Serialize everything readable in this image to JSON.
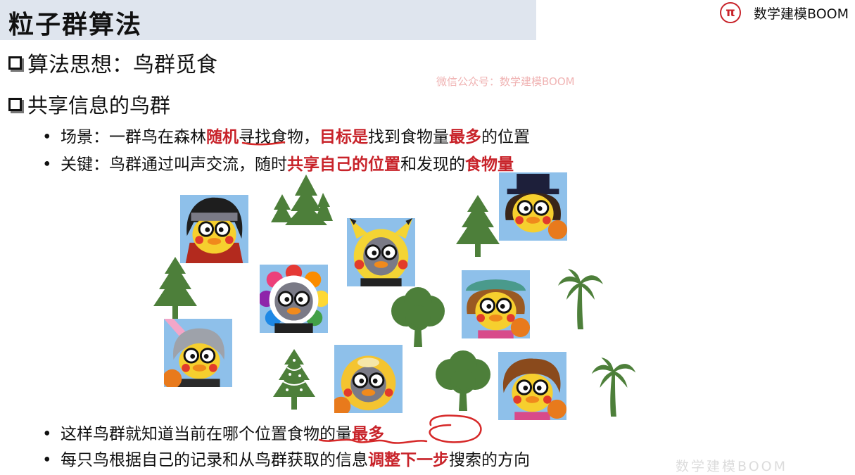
{
  "header": {
    "title": "粒子群算法",
    "brand": "数学建模BOOM",
    "brand_icon": "pi-icon"
  },
  "section1": {
    "text": "算法思想：鸟群觅食"
  },
  "section2": {
    "text": "共享信息的鸟群"
  },
  "watermark": "微信公众号：数学建模BOOM",
  "bullets": {
    "scene": {
      "a": "场景：一群鸟在森林",
      "b": "随机",
      "c": "寻找食物，",
      "d": "目标是",
      "e": "找到食物量",
      "f": "最多",
      "g": "的位置"
    },
    "key": {
      "a": "关键：鸟群通过叫声交流，随时",
      "b": "共享自己的位置",
      "c": "和发现的",
      "d": "食物量"
    },
    "know": {
      "a": "这样鸟群就知道当前在哪个位置食物的量",
      "b": "最多"
    },
    "adjust": {
      "a": "每只鸟根据自己的记录和从鸟群获取的信息",
      "b": "调整下一步",
      "c": "搜索的方向"
    }
  },
  "bottom_watermark": "数学建模BOOM",
  "colors": {
    "accent_red": "#c8232a",
    "tree_green": "#4d7f3a",
    "title_bg": "#dfe5ee"
  }
}
